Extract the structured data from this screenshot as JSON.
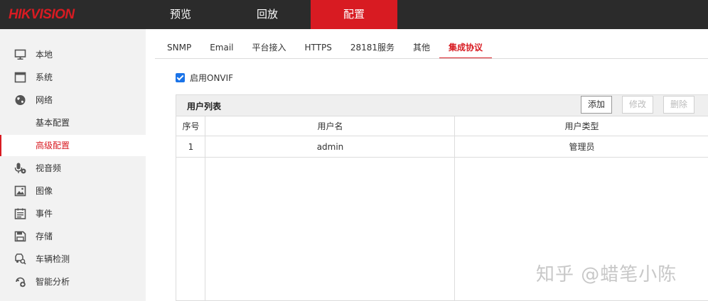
{
  "brand": {
    "logo_text": "HIKVISION",
    "accent_color": "#d81b22"
  },
  "topnav": {
    "items": [
      {
        "label": "预览",
        "active": false
      },
      {
        "label": "回放",
        "active": false
      },
      {
        "label": "配置",
        "active": true
      }
    ]
  },
  "sidebar": {
    "items": [
      {
        "label": "本地",
        "icon": "monitor-icon"
      },
      {
        "label": "系统",
        "icon": "system-window-icon"
      },
      {
        "label": "网络",
        "icon": "globe-icon"
      },
      {
        "label": "基本配置",
        "sub": true,
        "active": false
      },
      {
        "label": "高级配置",
        "sub": true,
        "active": true
      },
      {
        "label": "视音频",
        "icon": "microphone-icon"
      },
      {
        "label": "图像",
        "icon": "image-icon"
      },
      {
        "label": "事件",
        "icon": "event-list-icon"
      },
      {
        "label": "存储",
        "icon": "save-disk-icon"
      },
      {
        "label": "车辆检测",
        "icon": "vehicle-search-icon"
      },
      {
        "label": "智能分析",
        "icon": "smart-analysis-icon"
      }
    ]
  },
  "tabs": [
    {
      "label": "SNMP",
      "active": false
    },
    {
      "label": "Email",
      "active": false
    },
    {
      "label": "平台接入",
      "active": false
    },
    {
      "label": "HTTPS",
      "active": false
    },
    {
      "label": "28181服务",
      "active": false
    },
    {
      "label": "其他",
      "active": false
    },
    {
      "label": "集成协议",
      "active": true
    }
  ],
  "onvif": {
    "label": "启用ONVIF",
    "checked": true
  },
  "user_table": {
    "title": "用户列表",
    "buttons": {
      "add": "添加",
      "edit": "修改",
      "delete": "删除"
    },
    "columns": [
      "序号",
      "用户名",
      "用户类型"
    ],
    "rows": [
      {
        "index": "1",
        "username": "admin",
        "type": "管理员"
      }
    ]
  },
  "watermark": "知乎 @蜡笔小陈"
}
